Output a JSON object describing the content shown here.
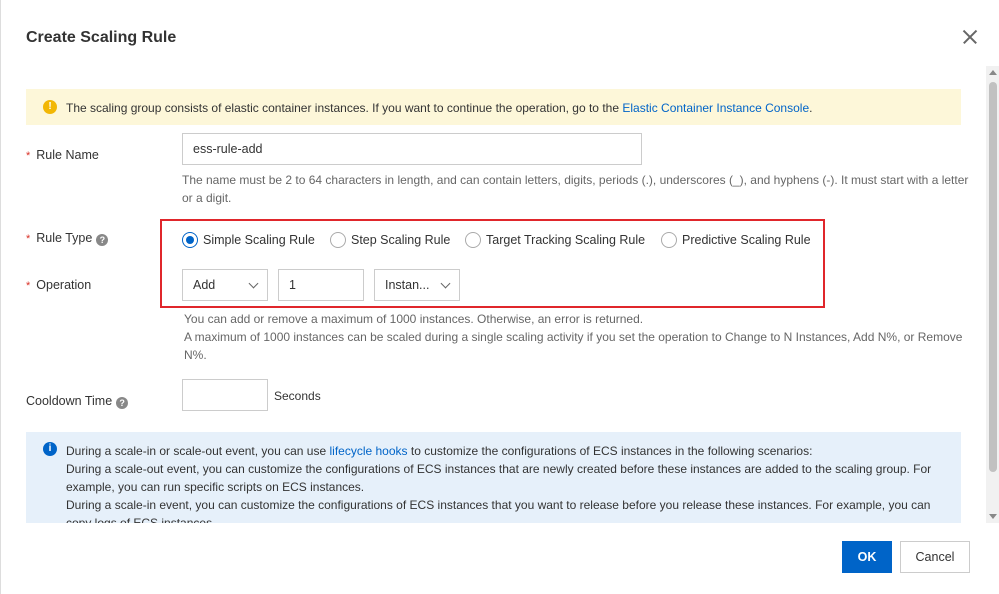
{
  "dialog": {
    "title": "Create Scaling Rule"
  },
  "warning": {
    "text": "The scaling group consists of elastic container instances. If you want to continue the operation, go to the ",
    "link": "Elastic Container Instance Console",
    "suffix": "."
  },
  "form": {
    "rule_name": {
      "required": "*",
      "label": "Rule Name",
      "value": "ess-rule-add",
      "hint": "The name must be 2 to 64 characters in length, and can contain letters, digits, periods (.), underscores (_), and hyphens (-). It must start with a letter or a digit."
    },
    "rule_type": {
      "required": "*",
      "label": "Rule Type",
      "options": [
        "Simple Scaling Rule",
        "Step Scaling Rule",
        "Target Tracking Scaling Rule",
        "Predictive Scaling Rule"
      ],
      "selected": "Simple Scaling Rule"
    },
    "operation": {
      "required": "*",
      "label": "Operation",
      "action": "Add",
      "amount": "1",
      "unit": "Instan...",
      "hint_1": "You can add or remove a maximum of 1000 instances. Otherwise, an error is returned.",
      "hint_2": "A maximum of 1000 instances can be scaled during a single scaling activity if you set the operation to Change to N Instances, Add N%, or Remove N%."
    },
    "cooldown": {
      "label": "Cooldown Time",
      "value": "",
      "unit": "Seconds"
    }
  },
  "info": {
    "line1_prefix": "During a scale-in or scale-out event, you can use ",
    "line1_link": "lifecycle hooks",
    "line1_suffix": " to customize the configurations of ECS instances in the following scenarios:",
    "line2": "During a scale-out event, you can customize the configurations of ECS instances that are newly created before these instances are added to the scaling group. For example, you can run specific scripts on ECS instances.",
    "line3": "During a scale-in event, you can customize the configurations of ECS instances that you want to release before you release these instances. For example, you can copy logs of ECS instances."
  },
  "footer": {
    "ok": "OK",
    "cancel": "Cancel"
  },
  "icons": {
    "warning": "warning-icon",
    "info": "info-icon",
    "help": "help-icon",
    "close": "close-icon"
  },
  "colors": {
    "primary": "#0064c8",
    "warning_bg": "#fdf7d9",
    "info_bg": "#e6f0fa",
    "highlight": "#e0262b",
    "required": "#d93026"
  }
}
